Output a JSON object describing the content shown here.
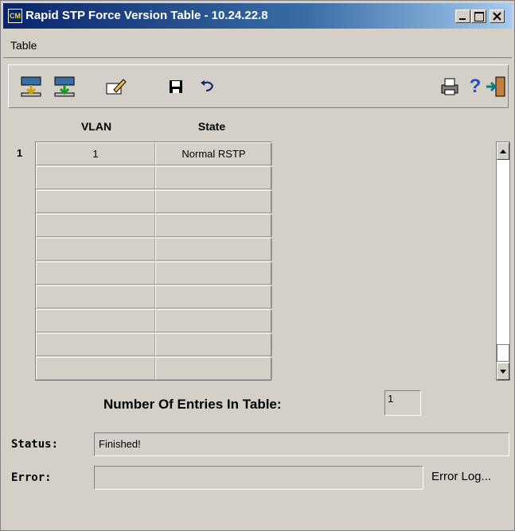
{
  "window": {
    "title": "Rapid STP Force Version Table - 10.24.22.8",
    "app_icon_text": "CM"
  },
  "menu": {
    "items": [
      {
        "label": "Table"
      }
    ]
  },
  "toolbar": {
    "icons": [
      "fetch-icon",
      "apply-icon",
      "edit-icon",
      "save-icon",
      "undo-icon",
      "print-icon",
      "help-icon",
      "exit-icon"
    ],
    "help_glyph": "?"
  },
  "table": {
    "columns": [
      "VLAN",
      "State"
    ],
    "row_number": "1",
    "rows": [
      {
        "vlan": "1",
        "state": "Normal RSTP"
      },
      {
        "vlan": "",
        "state": ""
      },
      {
        "vlan": "",
        "state": ""
      },
      {
        "vlan": "",
        "state": ""
      },
      {
        "vlan": "",
        "state": ""
      },
      {
        "vlan": "",
        "state": ""
      },
      {
        "vlan": "",
        "state": ""
      },
      {
        "vlan": "",
        "state": ""
      },
      {
        "vlan": "",
        "state": ""
      },
      {
        "vlan": "",
        "state": ""
      }
    ]
  },
  "entries": {
    "label": "Number Of Entries In Table:",
    "value": "1"
  },
  "status": {
    "label": "Status:",
    "value": "Finished!"
  },
  "error": {
    "label": "Error:",
    "value": "",
    "log_button": "Error Log..."
  }
}
